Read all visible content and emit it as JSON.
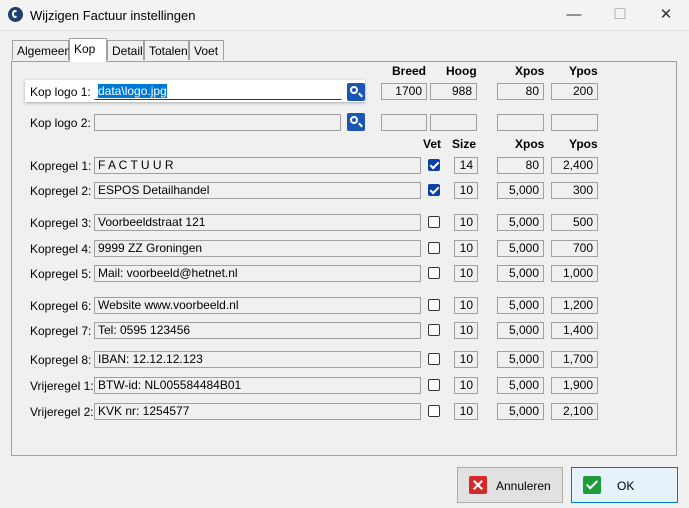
{
  "window": {
    "title": "Wijzigen Factuur instellingen",
    "minimize": "—",
    "maximize": "☐",
    "close": "✕"
  },
  "tabs": [
    {
      "label": "Algemeen"
    },
    {
      "label": "Kop"
    },
    {
      "label": "Detail"
    },
    {
      "label": "Totalen"
    },
    {
      "label": "Voet"
    }
  ],
  "logo_headers": {
    "breed": "Breed",
    "hoog": "Hoog",
    "xpos": "Xpos",
    "ypos": "Ypos"
  },
  "logos": [
    {
      "label": "Kop logo 1:",
      "value": "data\\logo.jpg",
      "breed": "1700",
      "hoog": "988",
      "xpos": "80",
      "ypos": "200"
    },
    {
      "label": "Kop logo 2:",
      "value": "",
      "breed": "",
      "hoog": "",
      "xpos": "",
      "ypos": ""
    }
  ],
  "line_headers": {
    "vet": "Vet",
    "size": "Size",
    "xpos": "Xpos",
    "ypos": "Ypos"
  },
  "lines": [
    {
      "label": "Kopregel 1:",
      "value": "F A C T U U R",
      "vet": true,
      "size": "14",
      "xpos": "80",
      "ypos": "2,400"
    },
    {
      "label": "Kopregel 2:",
      "value": "ESPOS Detailhandel",
      "vet": true,
      "size": "10",
      "xpos": "5,000",
      "ypos": "300"
    },
    {
      "label": "Kopregel 3:",
      "value": "Voorbeeldstraat 121",
      "vet": false,
      "size": "10",
      "xpos": "5,000",
      "ypos": "500"
    },
    {
      "label": "Kopregel 4:",
      "value": "9999 ZZ  Groningen",
      "vet": false,
      "size": "10",
      "xpos": "5,000",
      "ypos": "700"
    },
    {
      "label": "Kopregel 5:",
      "value": "Mail: voorbeeld@hetnet.nl",
      "vet": false,
      "size": "10",
      "xpos": "5,000",
      "ypos": "1,000"
    },
    {
      "label": "Kopregel 6:",
      "value": "Website www.voorbeeld.nl",
      "vet": false,
      "size": "10",
      "xpos": "5,000",
      "ypos": "1,200"
    },
    {
      "label": "Kopregel 7:",
      "value": "Tel: 0595 123456",
      "vet": false,
      "size": "10",
      "xpos": "5,000",
      "ypos": "1,400"
    },
    {
      "label": "Kopregel 8:",
      "value": "IBAN: 12.12.12.123",
      "vet": false,
      "size": "10",
      "xpos": "5,000",
      "ypos": "1,700"
    },
    {
      "label": "Vrijeregel 1:",
      "value": "BTW-id: NL005584484B01",
      "vet": false,
      "size": "10",
      "xpos": "5,000",
      "ypos": "1,900"
    },
    {
      "label": "Vrijeregel 2:",
      "value": "KVK nr: 1254577",
      "vet": false,
      "size": "10",
      "xpos": "5,000",
      "ypos": "2,100"
    }
  ],
  "buttons": {
    "cancel": "Annuleren",
    "ok": "OK"
  },
  "colors": {
    "checkbox_checked": "#0a3fa5",
    "search_button": "#1a56b4",
    "cancel_icon": "#d62a2a",
    "ok_icon": "#1e9e3a"
  }
}
